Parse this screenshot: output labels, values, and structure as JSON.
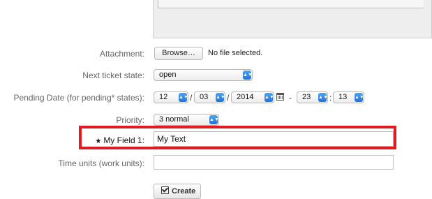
{
  "form": {
    "attachment": {
      "label": "Attachment:",
      "button": "Browse…",
      "status": "No file selected."
    },
    "next_state": {
      "label": "Next ticket state:",
      "value": "open"
    },
    "pending_date": {
      "label": "Pending Date (for pending* states):",
      "day": "12",
      "month": "03",
      "year": "2014",
      "hour": "23",
      "minute": "13",
      "sep1": "/",
      "sep2": "/",
      "sep3": "-",
      "sep4": ":"
    },
    "priority": {
      "label": "Priority:",
      "value": "3 normal"
    },
    "my_field": {
      "required_mark": "★",
      "label": "My Field 1:",
      "value": "My Text"
    },
    "time_units": {
      "label": "Time units (work units):",
      "value": ""
    },
    "create_label": "Create"
  },
  "icons": {
    "calendar": "calendar-icon",
    "select_arrow": "updown-arrow-icon",
    "create": "checkbox-icon"
  },
  "colors": {
    "highlight": "#e11b22",
    "select_accent": "#1f73e0"
  }
}
